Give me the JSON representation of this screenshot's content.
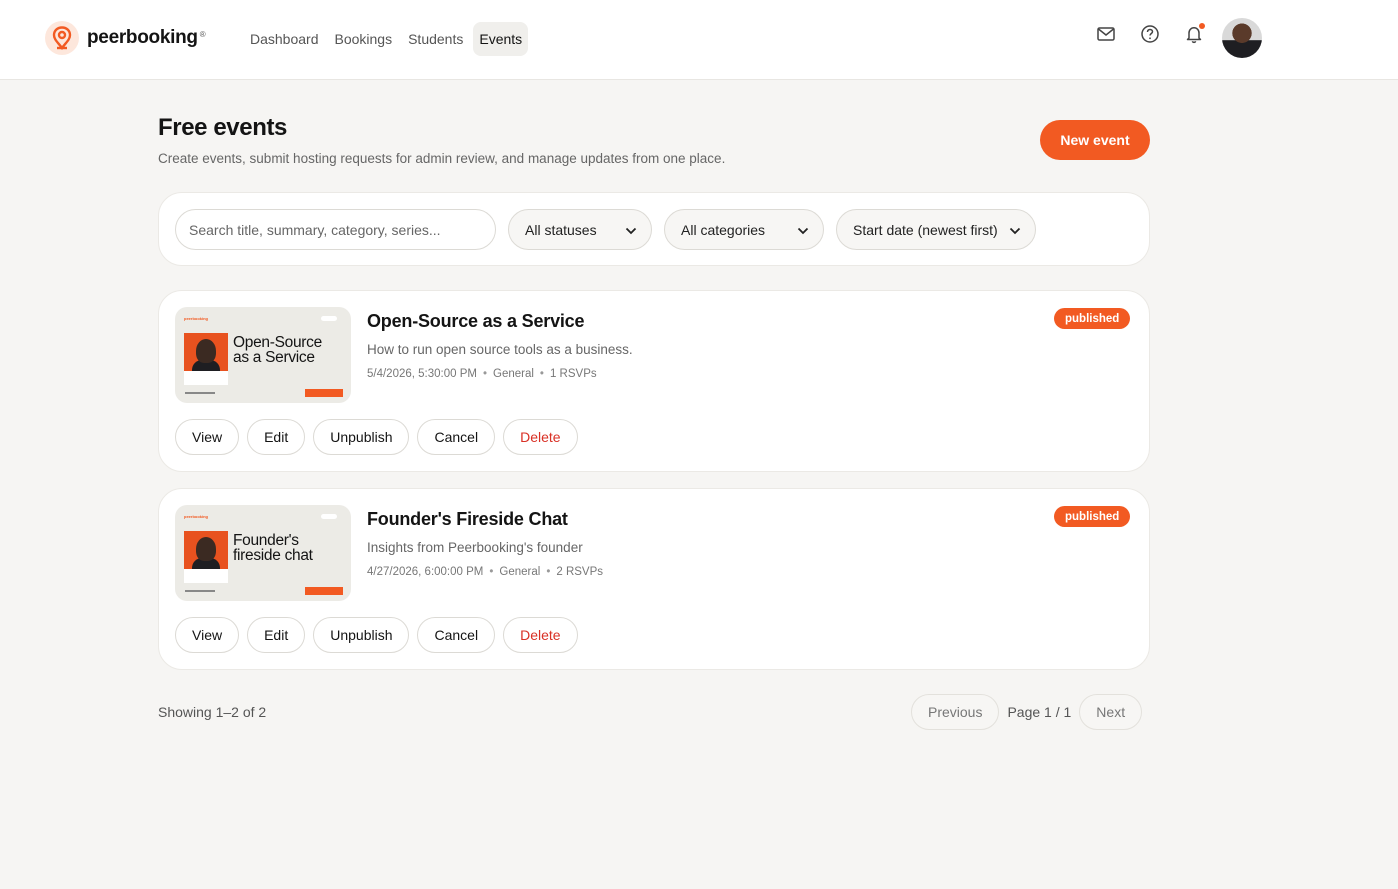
{
  "brand": {
    "name": "peerbooking",
    "reg": "®"
  },
  "nav": [
    {
      "label": "Dashboard"
    },
    {
      "label": "Bookings"
    },
    {
      "label": "Students"
    },
    {
      "label": "Events"
    }
  ],
  "accent": "#f25a22",
  "header": {
    "title": "Free events",
    "subtitle": "Create events, submit hosting requests for admin review, and manage updates from one place.",
    "new_event_label": "New event"
  },
  "filters": {
    "search_placeholder": "Search title, summary, category, series...",
    "status": "All statuses",
    "category": "All categories",
    "sort": "Start date (newest first)"
  },
  "events": [
    {
      "title": "Open-Source as a Service",
      "thumb_title_line1": "Open-Source",
      "thumb_title_line2": "as a Service",
      "summary": "How to run open source tools as a business.",
      "datetime": "5/4/2026, 5:30:00 PM",
      "category": "General",
      "rsvps": "1 RSVPs",
      "status": "published"
    },
    {
      "title": "Founder's Fireside Chat",
      "thumb_title_line1": "Founder's",
      "thumb_title_line2": "fireside chat",
      "summary": "Insights from Peerbooking's founder",
      "datetime": "4/27/2026, 6:00:00 PM",
      "category": "General",
      "rsvps": "2 RSVPs",
      "status": "published"
    }
  ],
  "actions": {
    "view": "View",
    "edit": "Edit",
    "unpublish": "Unpublish",
    "cancel": "Cancel",
    "delete": "Delete"
  },
  "pagination": {
    "showing": "Showing 1–2 of 2",
    "previous": "Previous",
    "page": "Page 1 / 1",
    "next": "Next"
  }
}
